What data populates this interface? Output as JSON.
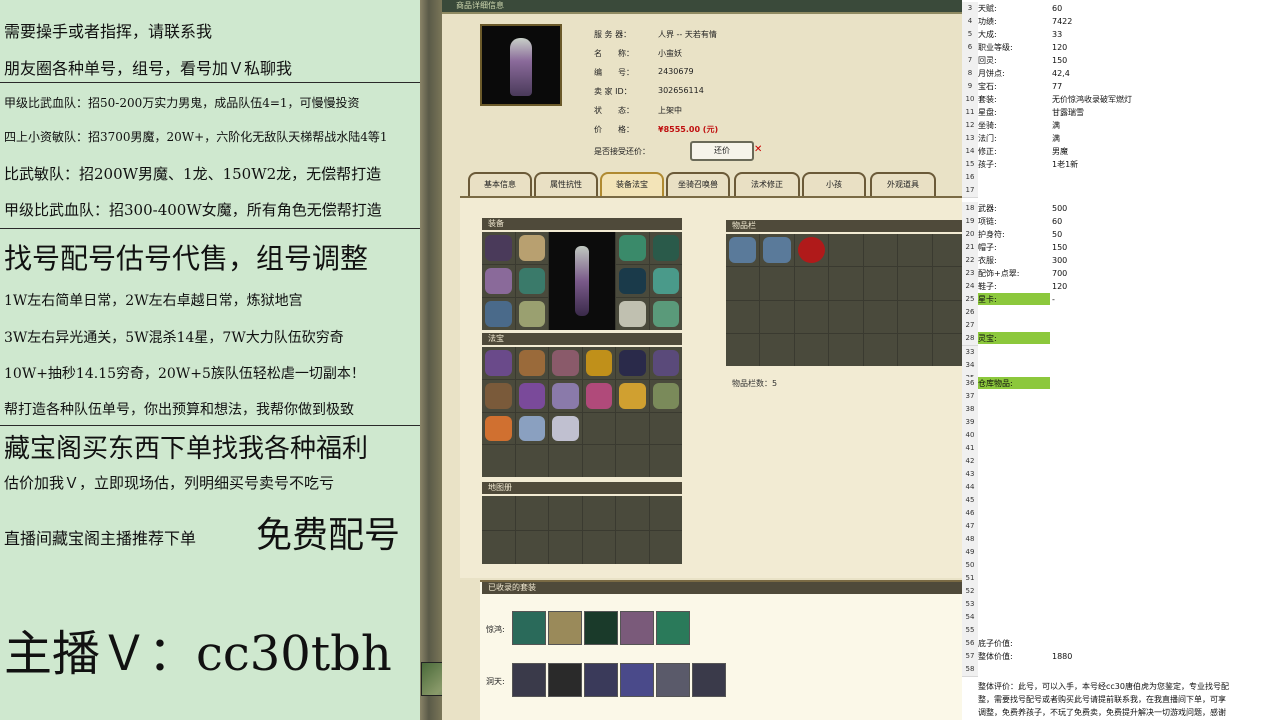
{
  "left_overlay": {
    "lines": [
      "需要操手或者指挥，请联系我",
      "朋友圈各种单号，组号，看号加Ｖ私聊我",
      "甲级比武血队：招50-200万实力男鬼，成品队伍4=1，可慢慢投资",
      "四上小资敏队：招3700男魔，20W+，六阶化无敌队天梯帮战水陆4等1",
      "比武敏队：招200W男魔、1龙、150W2龙，无偿帮打造",
      "甲级比武血队：招300-400W女魔，所有角色无偿帮打造",
      "找号配号估号代售，组号调整",
      "1W左右简单日常，2W左右卓越日常，炼狱地宫",
      "3W左右异光通关，5W混杀14星，7W大力队伍砍穷奇",
      "10W+抽秒14.15穷奇，20W+5族队伍轻松虐一切副本！",
      "帮打造各种队伍单号，你出预算和想法，我帮你做到极致",
      "藏宝阁买东西下单找我各种福利",
      "估价加我Ｖ，立即现场估，列明细买号卖号不吃亏",
      "直播间藏宝阁主播推荐下单",
      "免费配号",
      "主播Ｖ：cc30tbh"
    ]
  },
  "game": {
    "window_title": "商品详细信息",
    "info": [
      {
        "label": "服 务 器：",
        "value": "人界 -- 天若有情"
      },
      {
        "label": "名　　称：",
        "value": "小蛮妖"
      },
      {
        "label": "编　　号：",
        "value": "2430679"
      },
      {
        "label": "卖 家 ID：",
        "value": "302656114"
      },
      {
        "label": "状　　态：",
        "value": "上架中"
      },
      {
        "label": "价　　格：",
        "value": "¥8555.00 (元)"
      }
    ],
    "counter_offer_label": "是否接受还价：",
    "counter_offer_button": "还价",
    "tabs": [
      "基本信息",
      "属性抗性",
      "装备法宝",
      "坐骑召唤兽",
      "法术修正",
      "小孩",
      "外观道具"
    ],
    "active_tab": "装备法宝",
    "sections": {
      "equipment": "装备",
      "talisman": "法宝",
      "map_book": "地图册",
      "inventory": "物品栏",
      "inventory_count": "物品栏数：5",
      "collected_sets": "已收录的套装"
    },
    "set_rows": [
      "惊鸿:",
      "洞天:"
    ]
  },
  "sheet": {
    "rows": [
      {
        "n": "3",
        "k": "天赋:",
        "v": "60"
      },
      {
        "n": "4",
        "k": "功绩:",
        "v": "7422"
      },
      {
        "n": "5",
        "k": "大成:",
        "v": "33"
      },
      {
        "n": "6",
        "k": "职业等级:",
        "v": "120"
      },
      {
        "n": "7",
        "k": "回灵:",
        "v": "150"
      },
      {
        "n": "8",
        "k": "月饼点:",
        "v": "42,4"
      },
      {
        "n": "9",
        "k": "宝石:",
        "v": "77"
      },
      {
        "n": "10",
        "k": "套装:",
        "v": "无价惊鸿收录破军燃灯"
      },
      {
        "n": "11",
        "k": "星盘:",
        "v": "甘露瑞雪"
      },
      {
        "n": "12",
        "k": "坐骑:",
        "v": "满"
      },
      {
        "n": "13",
        "k": "法门:",
        "v": "满"
      },
      {
        "n": "14",
        "k": "修正:",
        "v": "男魔"
      },
      {
        "n": "15",
        "k": "孩子:",
        "v": "1老1新"
      },
      {
        "n": "16",
        "k": "",
        "v": ""
      },
      {
        "n": "17",
        "k": "",
        "v": ""
      },
      {
        "n": "18",
        "k": "武器:",
        "v": "500"
      },
      {
        "n": "19",
        "k": "项链:",
        "v": "60"
      },
      {
        "n": "20",
        "k": "护身符:",
        "v": "50"
      },
      {
        "n": "21",
        "k": "帽子:",
        "v": "150"
      },
      {
        "n": "22",
        "k": "衣服:",
        "v": "300"
      },
      {
        "n": "23",
        "k": "配饰+点翠:",
        "v": "700"
      },
      {
        "n": "24",
        "k": "鞋子:",
        "v": "120"
      },
      {
        "n": "25",
        "k": "星卡:",
        "v": "-"
      },
      {
        "n": "26",
        "k": "",
        "v": ""
      },
      {
        "n": "27",
        "k": "",
        "v": ""
      },
      {
        "n": "28",
        "k": "灵宝:",
        "v": ""
      },
      {
        "n": "33",
        "k": "",
        "v": ""
      },
      {
        "n": "34",
        "k": "",
        "v": ""
      },
      {
        "n": "35",
        "k": "",
        "v": ""
      },
      {
        "n": "36",
        "k": "仓库物品:",
        "v": ""
      },
      {
        "n": "37",
        "k": "",
        "v": ""
      },
      {
        "n": "38",
        "k": "",
        "v": ""
      },
      {
        "n": "39",
        "k": "",
        "v": ""
      },
      {
        "n": "40",
        "k": "",
        "v": ""
      },
      {
        "n": "41",
        "k": "",
        "v": ""
      },
      {
        "n": "42",
        "k": "",
        "v": ""
      },
      {
        "n": "43",
        "k": "",
        "v": ""
      },
      {
        "n": "44",
        "k": "",
        "v": ""
      },
      {
        "n": "45",
        "k": "",
        "v": ""
      },
      {
        "n": "46",
        "k": "",
        "v": ""
      },
      {
        "n": "47",
        "k": "",
        "v": ""
      },
      {
        "n": "48",
        "k": "",
        "v": ""
      },
      {
        "n": "49",
        "k": "",
        "v": ""
      },
      {
        "n": "50",
        "k": "",
        "v": ""
      },
      {
        "n": "51",
        "k": "",
        "v": ""
      },
      {
        "n": "52",
        "k": "",
        "v": ""
      },
      {
        "n": "53",
        "k": "",
        "v": ""
      },
      {
        "n": "54",
        "k": "",
        "v": ""
      },
      {
        "n": "55",
        "k": "",
        "v": ""
      },
      {
        "n": "56",
        "k": "底子价值:",
        "v": ""
      },
      {
        "n": "57",
        "k": "整体价值:",
        "v": "1880"
      },
      {
        "n": "58",
        "k": "",
        "v": ""
      }
    ],
    "bottom_text": [
      "整体评价：此号，可以入手，本号经cc30唐伯虎为您鉴定，专业找号配",
      "整，需要找号配号或者购买此号请提前联系我，在我直播间下单，可享",
      "调整，免费养孩子，不玩了免费卖，免费提升解决一切游戏问题，感谢"
    ]
  },
  "watermark": {
    "text": "CC直播"
  }
}
